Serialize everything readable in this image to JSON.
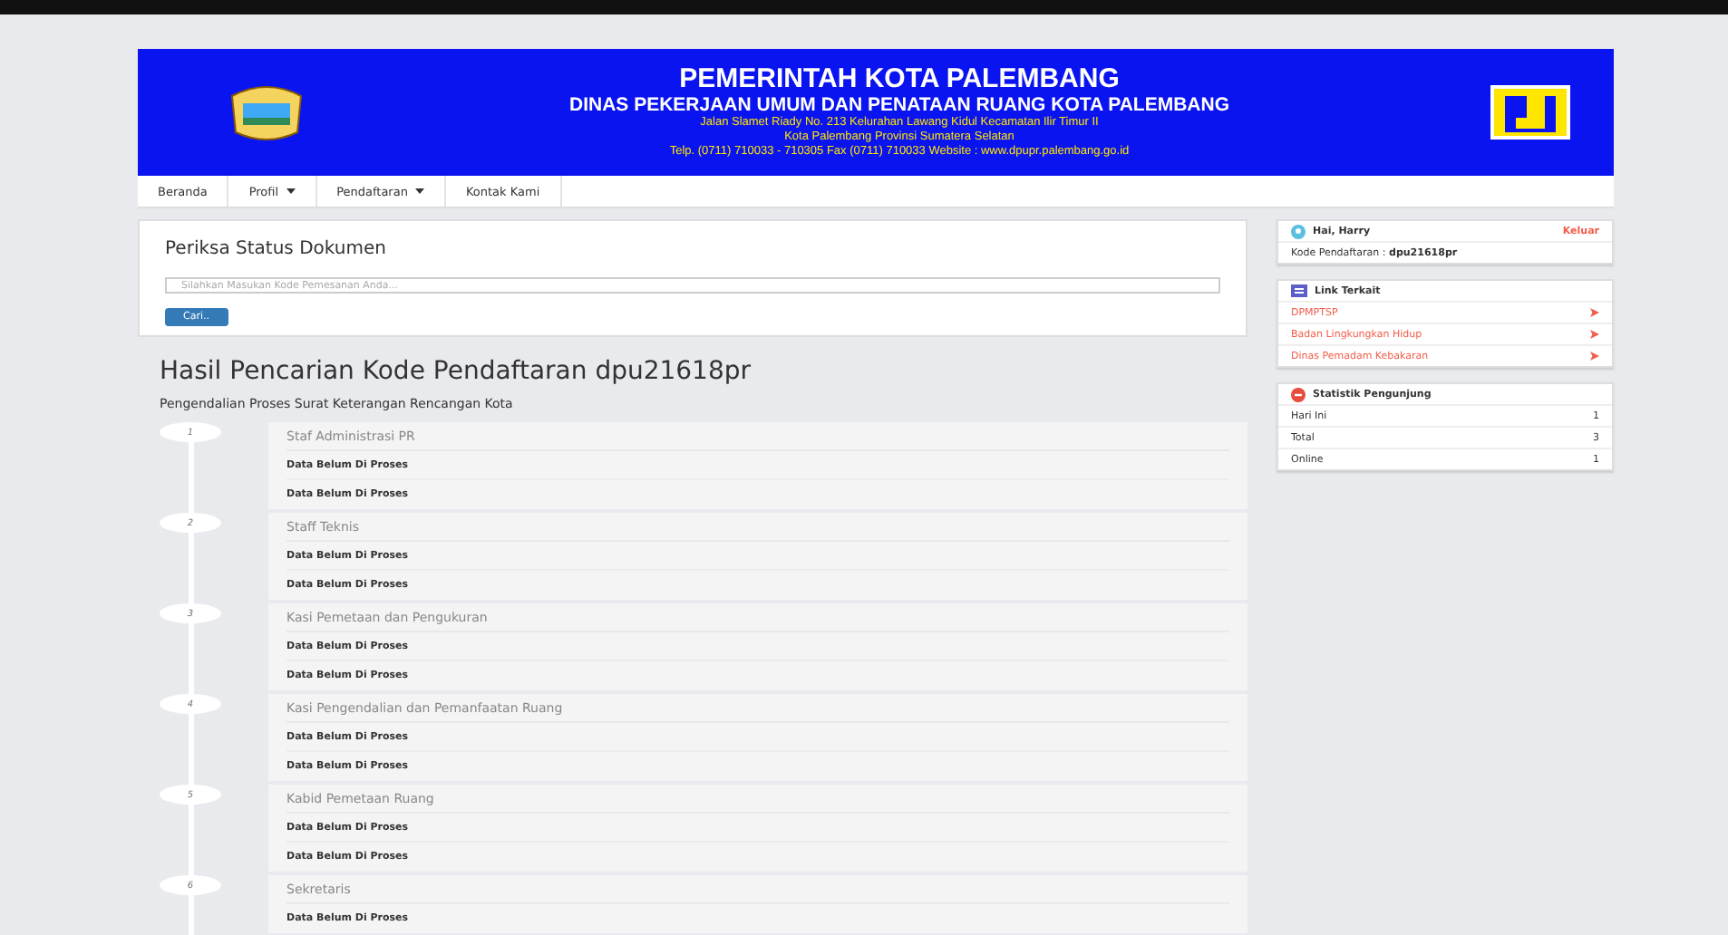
{
  "header": {
    "title": "PEMERINTAH KOTA PALEMBANG",
    "subtitle": "DINAS PEKERJAAN UMUM DAN PENATAAN RUANG KOTA PALEMBANG",
    "address_lines": [
      "Jalan Slamet Riady No. 213 Kelurahan Lawang Kidul Kecamatan Ilir Timur II",
      "Kota Palembang Provinsi Sumatera Selatan",
      "Telp. (0711) 710033 - 710305 Fax (0711) 710033 Website : www.dpupr.palembang.go.id"
    ]
  },
  "nav": [
    {
      "label": "Beranda",
      "dropdown": false
    },
    {
      "label": "Profil",
      "dropdown": true
    },
    {
      "label": "Pendaftaran",
      "dropdown": true
    },
    {
      "label": "Kontak Kami",
      "dropdown": false
    }
  ],
  "search_card": {
    "title": "Periksa Status Dokumen",
    "placeholder": "Silahkan Masukan Kode Pemesanan Anda...",
    "button": "Cari.."
  },
  "result": {
    "title": "Hasil Pencarian Kode Pendaftaran dpu21618pr",
    "subtitle": "Pengendalian Proses Surat Keterangan Rencangan Kota"
  },
  "timeline": [
    {
      "number": "1",
      "title": "Staf Administrasi PR",
      "entries": [
        "Data Belum Di Proses",
        "Data Belum Di Proses"
      ]
    },
    {
      "number": "2",
      "title": "Staff Teknis",
      "entries": [
        "Data Belum Di Proses",
        "Data Belum Di Proses"
      ]
    },
    {
      "number": "3",
      "title": "Kasi Pemetaan dan Pengukuran",
      "entries": [
        "Data Belum Di Proses",
        "Data Belum Di Proses"
      ]
    },
    {
      "number": "4",
      "title": "Kasi Pengendalian dan Pemanfaatan Ruang",
      "entries": [
        "Data Belum Di Proses",
        "Data Belum Di Proses"
      ]
    },
    {
      "number": "5",
      "title": "Kabid Pemetaan Ruang",
      "entries": [
        "Data Belum Di Proses",
        "Data Belum Di Proses"
      ]
    },
    {
      "number": "6",
      "title": "Sekretaris",
      "entries": [
        "Data Belum Di Proses"
      ]
    }
  ],
  "user_panel": {
    "greeting": "Hai, Harry",
    "logout": "Keluar",
    "code_label": "Kode Pendaftaran :",
    "code": "dpu21618pr"
  },
  "links_panel": {
    "title": "Link Terkait",
    "links": [
      "DPMPTSP",
      "Badan Lingkungkan Hidup",
      "Dinas Pemadam Kebakaran"
    ]
  },
  "stats_panel": {
    "title": "Statistik Pengunjung",
    "rows": [
      {
        "label": "Hari Ini",
        "value": "1"
      },
      {
        "label": "Total",
        "value": "3"
      },
      {
        "label": "Online",
        "value": "1"
      }
    ]
  }
}
